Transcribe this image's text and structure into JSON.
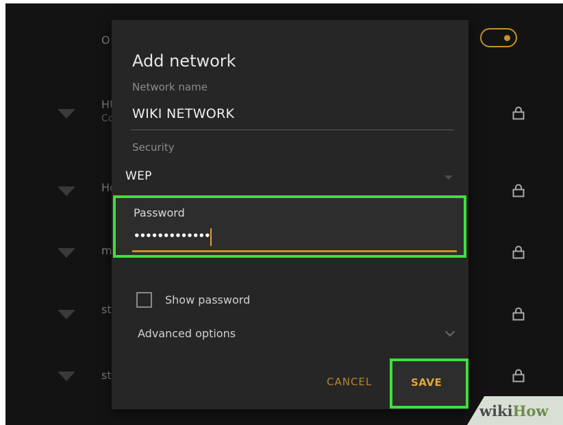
{
  "background_list": {
    "header_fragment": "O",
    "networks": [
      {
        "name": "HU",
        "sub": "Co"
      },
      {
        "name": "Ho",
        "sub": ""
      },
      {
        "name": "m",
        "sub": ""
      },
      {
        "name": "st",
        "sub": ""
      },
      {
        "name": "st",
        "sub": ""
      }
    ],
    "wifi_toggle_on": true
  },
  "dialog": {
    "title": "Add network",
    "network_name_label": "Network name",
    "network_name_value": "WIKI NETWORK",
    "security_label": "Security",
    "security_value": "WEP",
    "password_label": "Password",
    "password_masked": "•••••••••••••",
    "show_password_label": "Show password",
    "show_password_checked": false,
    "advanced_options_label": "Advanced options",
    "cancel_label": "CANCEL",
    "save_label": "SAVE"
  },
  "watermark": {
    "part1": "wiki",
    "part2": "How"
  },
  "colors": {
    "accent": "#c8912a",
    "highlight": "#3be13b",
    "dialog_bg": "#262626",
    "screen_bg": "#131313"
  },
  "icons": [
    "wifi-icon",
    "lock-icon",
    "dropdown-arrow-icon",
    "chevron-down-icon",
    "checkbox-icon"
  ]
}
